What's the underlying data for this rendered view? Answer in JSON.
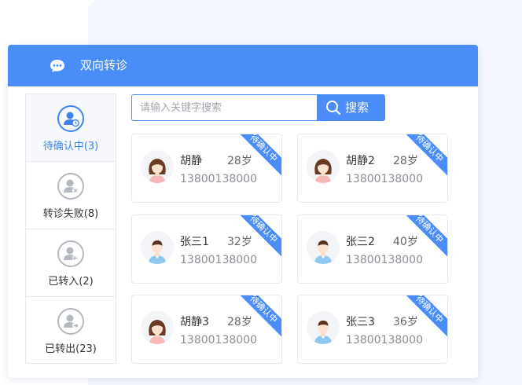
{
  "header": {
    "title": "双向转诊"
  },
  "sidebar": {
    "items": [
      {
        "label": "待确认中(3)"
      },
      {
        "label": "转诊失败(8)"
      },
      {
        "label": "已转入(2)"
      },
      {
        "label": "已转出(23)"
      }
    ]
  },
  "search": {
    "placeholder": "请输入关键字搜索",
    "value": "",
    "button_label": "搜索"
  },
  "patients": [
    {
      "name": "胡静",
      "age": "28岁",
      "phone": "13800138000",
      "status": "待确认中",
      "gender": "female"
    },
    {
      "name": "胡静2",
      "age": "28岁",
      "phone": "13800138000",
      "status": "待确认中",
      "gender": "female"
    },
    {
      "name": "张三1",
      "age": "32岁",
      "phone": "13800138000",
      "status": "待确认中",
      "gender": "male"
    },
    {
      "name": "张三2",
      "age": "40岁",
      "phone": "13800138000",
      "status": "待确认中",
      "gender": "male"
    },
    {
      "name": "胡静3",
      "age": "28岁",
      "phone": "13800138000",
      "status": "待确认中",
      "gender": "female"
    },
    {
      "name": "张三3",
      "age": "36岁",
      "phone": "13800138000",
      "status": "待确认中",
      "gender": "male"
    }
  ],
  "colors": {
    "accent": "#4a8df8",
    "icon_gray": "#b4b8c0",
    "background": "#f4f7fd"
  }
}
